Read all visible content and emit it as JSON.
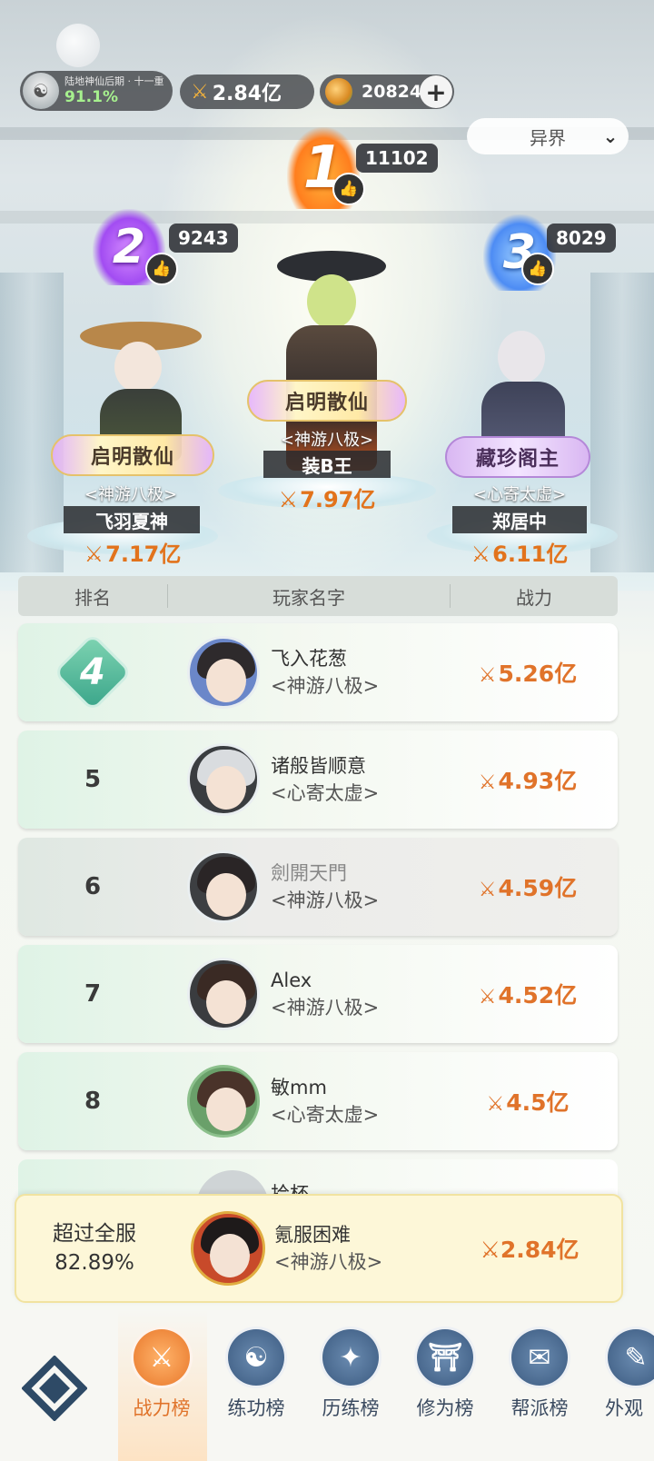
{
  "status_bar": {
    "realm": "陆地神仙后期 · 十一重",
    "percent": "91.1%",
    "power": "2.84亿",
    "currency": "20824",
    "plus_icon": "plus-icon"
  },
  "filter": {
    "label": "异界",
    "icon": "chevron-down-icon"
  },
  "power_icon_glyph": "⚔",
  "podium": [
    {
      "rank": "1",
      "likes": "11102",
      "title": "启明散仙",
      "guild": "<神游八极>",
      "name": "装B王",
      "power": "7.97亿"
    },
    {
      "rank": "2",
      "likes": "9243",
      "title": "启明散仙",
      "guild": "<神游八极>",
      "name": "飞羽夏神",
      "power": "7.17亿"
    },
    {
      "rank": "3",
      "likes": "8029",
      "title": "藏珍阁主",
      "guild": "<心寄太虚>",
      "name": "郑居中",
      "power": "6.11亿"
    }
  ],
  "table": {
    "headers": [
      "排名",
      "玩家名字",
      "战力"
    ],
    "rows": [
      {
        "rank": "4",
        "name": "飞入花葱",
        "guild": "<神游八极>",
        "power": "5.26亿"
      },
      {
        "rank": "5",
        "name": "诸般皆顺意",
        "guild": "<心寄太虚>",
        "power": "4.93亿"
      },
      {
        "rank": "6",
        "name": "劍開天門",
        "guild": "<神游八极>",
        "power": "4.59亿"
      },
      {
        "rank": "7",
        "name": "Alex",
        "guild": "<神游八极>",
        "power": "4.52亿"
      },
      {
        "rank": "8",
        "name": "敏mm",
        "guild": "<心寄太虚>",
        "power": "4.5亿"
      }
    ],
    "partial_row_name": "拾杯"
  },
  "my_rank": {
    "exceed_label": "超过全服",
    "exceed_value": "82.89%",
    "name": "氪服困难",
    "guild": "<神游八极>",
    "power": "2.84亿"
  },
  "nav": {
    "items": [
      {
        "label": "战力榜",
        "icon": "swords-icon",
        "active": true
      },
      {
        "label": "练功榜",
        "icon": "yin-yang-icon",
        "active": false
      },
      {
        "label": "历练榜",
        "icon": "compass-star-icon",
        "active": false
      },
      {
        "label": "修为榜",
        "icon": "hat-icon",
        "active": false
      },
      {
        "label": "帮派榜",
        "icon": "scroll-icon",
        "active": false
      },
      {
        "label": "外观",
        "icon": "brush-icon",
        "active": false
      }
    ],
    "home_icon": "diamond-menu-icon"
  },
  "colors": {
    "accent": "#e0732a",
    "rank1": "#ff8a1e",
    "rank2": "#a24cf2",
    "rank3": "#4d8cf4",
    "rank4_gem": "#3aa58a"
  }
}
